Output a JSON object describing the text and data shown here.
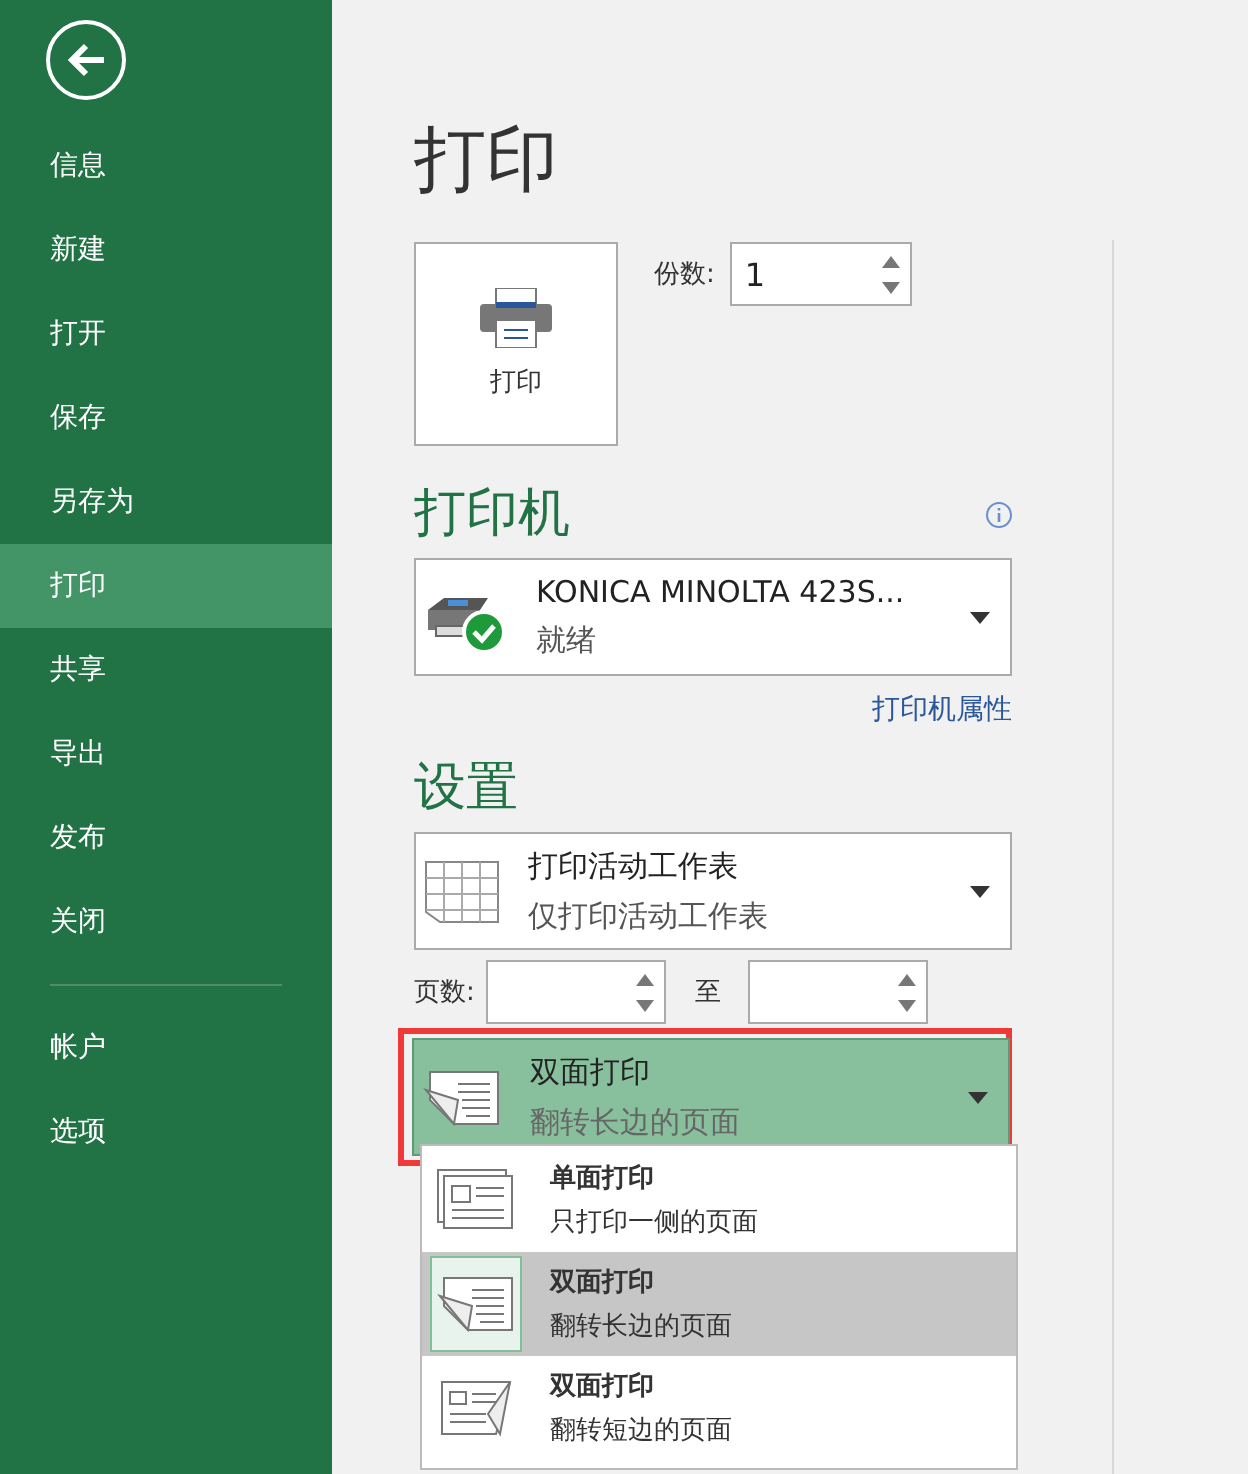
{
  "sidebar": {
    "items": [
      {
        "label": "信息",
        "selected": false
      },
      {
        "label": "新建",
        "selected": false
      },
      {
        "label": "打开",
        "selected": false
      },
      {
        "label": "保存",
        "selected": false
      },
      {
        "label": "另存为",
        "selected": false
      },
      {
        "label": "打印",
        "selected": true
      },
      {
        "label": "共享",
        "selected": false
      },
      {
        "label": "导出",
        "selected": false
      },
      {
        "label": "发布",
        "selected": false
      },
      {
        "label": "关闭",
        "selected": false
      }
    ],
    "footer_items": [
      {
        "label": "帐户",
        "selected": false
      },
      {
        "label": "选项",
        "selected": false
      }
    ]
  },
  "title": "打印",
  "print_button": {
    "label": "打印"
  },
  "copies": {
    "label": "份数:",
    "value": "1"
  },
  "printer": {
    "heading": "打印机",
    "name": "KONICA MINOLTA 423S...",
    "status": "就绪",
    "properties_link": "打印机属性"
  },
  "settings": {
    "heading": "设置",
    "scope": {
      "title": "打印活动工作表",
      "subtitle": "仅打印活动工作表"
    },
    "pages": {
      "label": "页数:",
      "to_label": "至"
    },
    "duplex": {
      "title": "双面打印",
      "subtitle": "翻转长边的页面",
      "kind": "duplex-long",
      "highlighted": true,
      "expanded": true
    },
    "duplex_options": [
      {
        "kind": "single",
        "title": "单面打印",
        "subtitle": "只打印一侧的页面",
        "selected": false
      },
      {
        "kind": "duplex-long",
        "title": "双面打印",
        "subtitle": "翻转长边的页面",
        "selected": true
      },
      {
        "kind": "duplex-short",
        "title": "双面打印",
        "subtitle": "翻转短边的页面",
        "selected": false
      }
    ]
  }
}
